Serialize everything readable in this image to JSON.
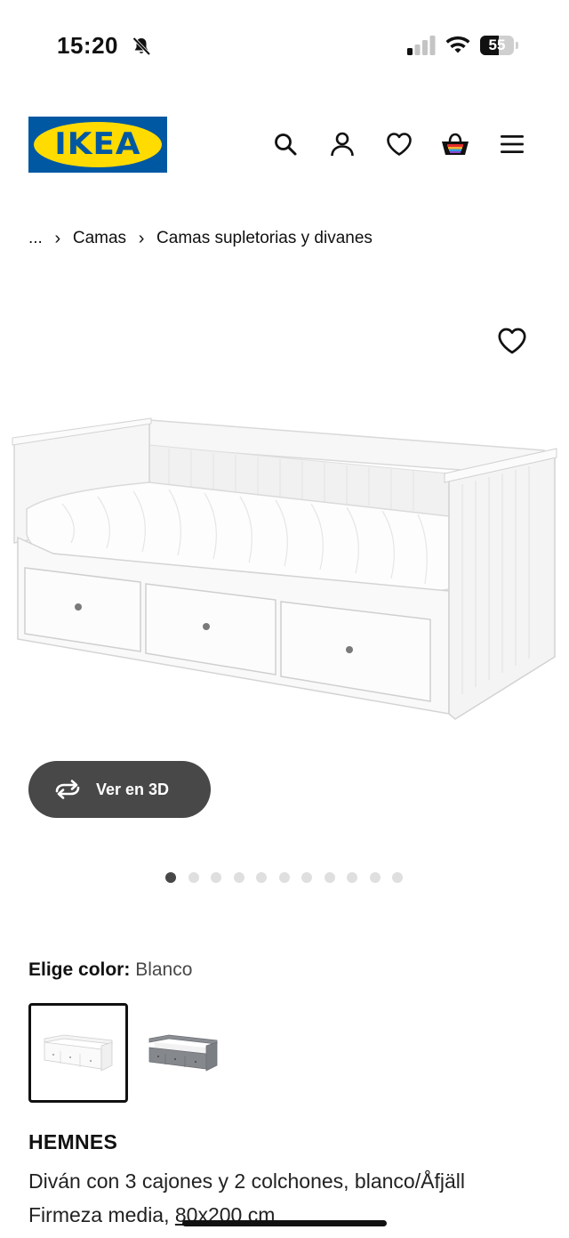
{
  "status_bar": {
    "time": "15:20",
    "battery_level": "55",
    "battery_fraction": 0.55,
    "icons": [
      "bell-slash-icon",
      "signal-icon",
      "wifi-icon",
      "battery-icon"
    ]
  },
  "header": {
    "logo_text": "IKEA",
    "brand_colors": {
      "blue": "#0058a3",
      "yellow": "#ffdb00"
    },
    "icons": [
      "search-icon",
      "user-icon",
      "heart-icon",
      "cart-icon",
      "menu-icon"
    ]
  },
  "breadcrumb": {
    "ellipsis": "...",
    "separator": "›",
    "items": [
      "Camas",
      "Camas supletorias y divanes"
    ]
  },
  "gallery": {
    "view_3d_label": "Ver en 3D",
    "total_images": 11,
    "active_index": 0
  },
  "color_selector": {
    "label": "Elige color:",
    "value": "Blanco",
    "options": [
      {
        "color": "#ffffff",
        "selected": true
      },
      {
        "color": "#7e8186",
        "selected": false
      }
    ]
  },
  "product": {
    "name": "HEMNES",
    "description": "Diván con 3 cajones y 2 colchones, blanco/Åfjäll",
    "firmness": "Firmeza media,",
    "size": "80x200 cm"
  }
}
